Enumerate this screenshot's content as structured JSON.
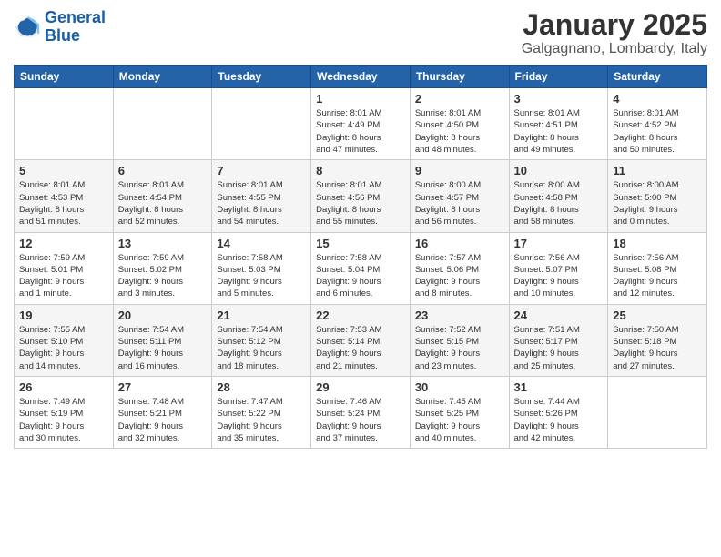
{
  "logo": {
    "line1": "General",
    "line2": "Blue"
  },
  "header": {
    "month": "January 2025",
    "location": "Galgagnano, Lombardy, Italy"
  },
  "weekdays": [
    "Sunday",
    "Monday",
    "Tuesday",
    "Wednesday",
    "Thursday",
    "Friday",
    "Saturday"
  ],
  "weeks": [
    [
      {
        "day": "",
        "info": ""
      },
      {
        "day": "",
        "info": ""
      },
      {
        "day": "",
        "info": ""
      },
      {
        "day": "1",
        "info": "Sunrise: 8:01 AM\nSunset: 4:49 PM\nDaylight: 8 hours\nand 47 minutes."
      },
      {
        "day": "2",
        "info": "Sunrise: 8:01 AM\nSunset: 4:50 PM\nDaylight: 8 hours\nand 48 minutes."
      },
      {
        "day": "3",
        "info": "Sunrise: 8:01 AM\nSunset: 4:51 PM\nDaylight: 8 hours\nand 49 minutes."
      },
      {
        "day": "4",
        "info": "Sunrise: 8:01 AM\nSunset: 4:52 PM\nDaylight: 8 hours\nand 50 minutes."
      }
    ],
    [
      {
        "day": "5",
        "info": "Sunrise: 8:01 AM\nSunset: 4:53 PM\nDaylight: 8 hours\nand 51 minutes."
      },
      {
        "day": "6",
        "info": "Sunrise: 8:01 AM\nSunset: 4:54 PM\nDaylight: 8 hours\nand 52 minutes."
      },
      {
        "day": "7",
        "info": "Sunrise: 8:01 AM\nSunset: 4:55 PM\nDaylight: 8 hours\nand 54 minutes."
      },
      {
        "day": "8",
        "info": "Sunrise: 8:01 AM\nSunset: 4:56 PM\nDaylight: 8 hours\nand 55 minutes."
      },
      {
        "day": "9",
        "info": "Sunrise: 8:00 AM\nSunset: 4:57 PM\nDaylight: 8 hours\nand 56 minutes."
      },
      {
        "day": "10",
        "info": "Sunrise: 8:00 AM\nSunset: 4:58 PM\nDaylight: 8 hours\nand 58 minutes."
      },
      {
        "day": "11",
        "info": "Sunrise: 8:00 AM\nSunset: 5:00 PM\nDaylight: 9 hours\nand 0 minutes."
      }
    ],
    [
      {
        "day": "12",
        "info": "Sunrise: 7:59 AM\nSunset: 5:01 PM\nDaylight: 9 hours\nand 1 minute."
      },
      {
        "day": "13",
        "info": "Sunrise: 7:59 AM\nSunset: 5:02 PM\nDaylight: 9 hours\nand 3 minutes."
      },
      {
        "day": "14",
        "info": "Sunrise: 7:58 AM\nSunset: 5:03 PM\nDaylight: 9 hours\nand 5 minutes."
      },
      {
        "day": "15",
        "info": "Sunrise: 7:58 AM\nSunset: 5:04 PM\nDaylight: 9 hours\nand 6 minutes."
      },
      {
        "day": "16",
        "info": "Sunrise: 7:57 AM\nSunset: 5:06 PM\nDaylight: 9 hours\nand 8 minutes."
      },
      {
        "day": "17",
        "info": "Sunrise: 7:56 AM\nSunset: 5:07 PM\nDaylight: 9 hours\nand 10 minutes."
      },
      {
        "day": "18",
        "info": "Sunrise: 7:56 AM\nSunset: 5:08 PM\nDaylight: 9 hours\nand 12 minutes."
      }
    ],
    [
      {
        "day": "19",
        "info": "Sunrise: 7:55 AM\nSunset: 5:10 PM\nDaylight: 9 hours\nand 14 minutes."
      },
      {
        "day": "20",
        "info": "Sunrise: 7:54 AM\nSunset: 5:11 PM\nDaylight: 9 hours\nand 16 minutes."
      },
      {
        "day": "21",
        "info": "Sunrise: 7:54 AM\nSunset: 5:12 PM\nDaylight: 9 hours\nand 18 minutes."
      },
      {
        "day": "22",
        "info": "Sunrise: 7:53 AM\nSunset: 5:14 PM\nDaylight: 9 hours\nand 21 minutes."
      },
      {
        "day": "23",
        "info": "Sunrise: 7:52 AM\nSunset: 5:15 PM\nDaylight: 9 hours\nand 23 minutes."
      },
      {
        "day": "24",
        "info": "Sunrise: 7:51 AM\nSunset: 5:17 PM\nDaylight: 9 hours\nand 25 minutes."
      },
      {
        "day": "25",
        "info": "Sunrise: 7:50 AM\nSunset: 5:18 PM\nDaylight: 9 hours\nand 27 minutes."
      }
    ],
    [
      {
        "day": "26",
        "info": "Sunrise: 7:49 AM\nSunset: 5:19 PM\nDaylight: 9 hours\nand 30 minutes."
      },
      {
        "day": "27",
        "info": "Sunrise: 7:48 AM\nSunset: 5:21 PM\nDaylight: 9 hours\nand 32 minutes."
      },
      {
        "day": "28",
        "info": "Sunrise: 7:47 AM\nSunset: 5:22 PM\nDaylight: 9 hours\nand 35 minutes."
      },
      {
        "day": "29",
        "info": "Sunrise: 7:46 AM\nSunset: 5:24 PM\nDaylight: 9 hours\nand 37 minutes."
      },
      {
        "day": "30",
        "info": "Sunrise: 7:45 AM\nSunset: 5:25 PM\nDaylight: 9 hours\nand 40 minutes."
      },
      {
        "day": "31",
        "info": "Sunrise: 7:44 AM\nSunset: 5:26 PM\nDaylight: 9 hours\nand 42 minutes."
      },
      {
        "day": "",
        "info": ""
      }
    ]
  ]
}
